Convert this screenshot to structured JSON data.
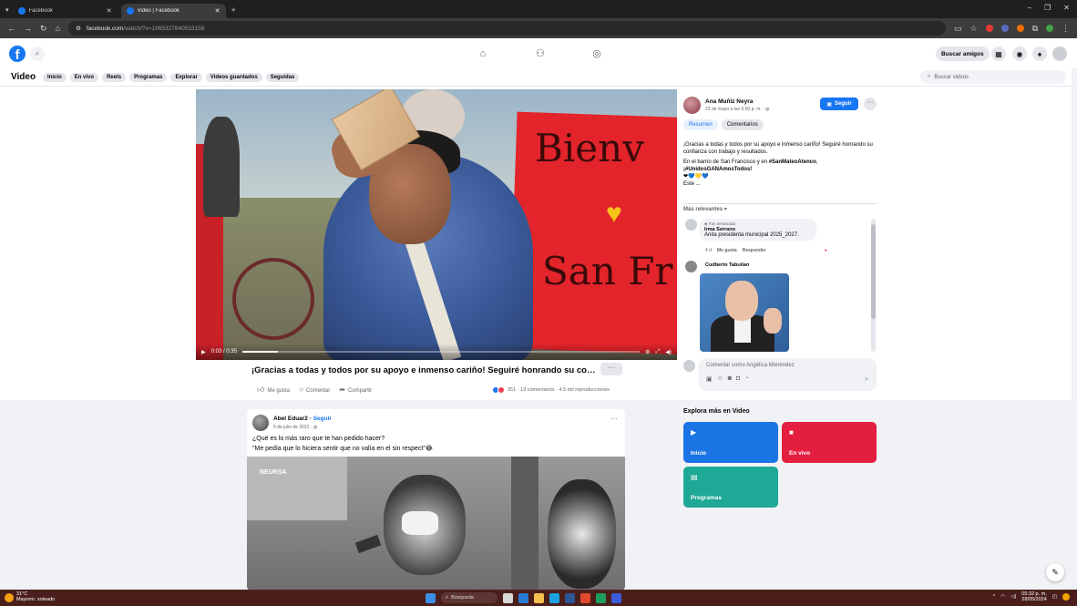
{
  "browser": {
    "tabs": [
      {
        "title": "Facebook",
        "active": false
      },
      {
        "title": "Video | Facebook",
        "active": true
      }
    ],
    "url_host": "facebook.com",
    "url_path": "/watch/?v=1965327640533156"
  },
  "fb": {
    "find_friends": "Buscar amigos"
  },
  "subnav": {
    "title": "Video",
    "pills": [
      "Inicio",
      "En vivo",
      "Reels",
      "Programas",
      "Explorar",
      "Videos guardados",
      "Seguidas"
    ],
    "search_placeholder": "Buscar videos"
  },
  "video": {
    "time": "0:03 / 0:35",
    "progress": 0.09,
    "title": "¡Gracias a todas y todos por su apoyo e inmenso cariño! Seguiré honrando su confi...",
    "more": "···",
    "actions": {
      "like": "Me gusta",
      "comment": "Comentar",
      "share": "Compartir"
    },
    "stats": "351 · 13 comentarios · 4.5 mil reproducciones",
    "sign_line1": "Bienv",
    "sign_line2": "San Fr"
  },
  "post": {
    "author": "Ana Muñiz Neyra",
    "date": "23 de mayo a las 6:00 p. m. ·",
    "follow": "Seguir",
    "more": "···",
    "tabs": [
      "Resumen",
      "Comentarios"
    ],
    "desc_p1": "¡Gracias a todas y todos por su apoyo e inmenso cariño! Seguiré honrando su confianza con trabajo y resultados.",
    "desc_p2a": "En el barrio de San Francisco y en ",
    "desc_p2_tag": "#SanMateoAtenco",
    "desc_p2b": ",",
    "desc_p3": "¡#UnidosGANAmosTodos!",
    "desc_emojis": "❤💙💛💙",
    "desc_more": "Este ...",
    "relevance": "Más relevantes ▾",
    "comments": [
      {
        "badge": "Fan destacado",
        "name": "Irma Serrano",
        "text": "Anita presidenta municipal 2025_2027.",
        "age": "4 d",
        "like": "Me gusta",
        "reply": "Responder"
      },
      {
        "name": "Cudberto Tabuilan"
      }
    ],
    "compose_placeholder": "Comentar como Angélica Menéndez"
  },
  "feed_card": {
    "author": "Abel Eduar2",
    "follow": "Seguir",
    "sep": " · ",
    "date": "5 de julio de 2022 ·",
    "question": "¿Qué es lo más raro que te han pedido hacer?",
    "quote": "\"Me pedía que lo hiciera sentir que no valía en el sin respect\"😂",
    "brand": "NEURSA"
  },
  "explore": {
    "title": "Explora más en Video",
    "tiles": [
      {
        "label": "Inicio",
        "color": "#1b74e4",
        "icon": "play-icon"
      },
      {
        "label": "En vivo",
        "color": "#e41e3f",
        "icon": "live-icon"
      },
      {
        "label": "Programas",
        "color": "#1ea896",
        "icon": "shows-icon"
      }
    ]
  },
  "taskbar": {
    "temp": "31°C",
    "weather": "Mayorm. soleado",
    "search": "Búsqueda",
    "time": "05:32 p. m.",
    "date": "28/05/2024"
  }
}
